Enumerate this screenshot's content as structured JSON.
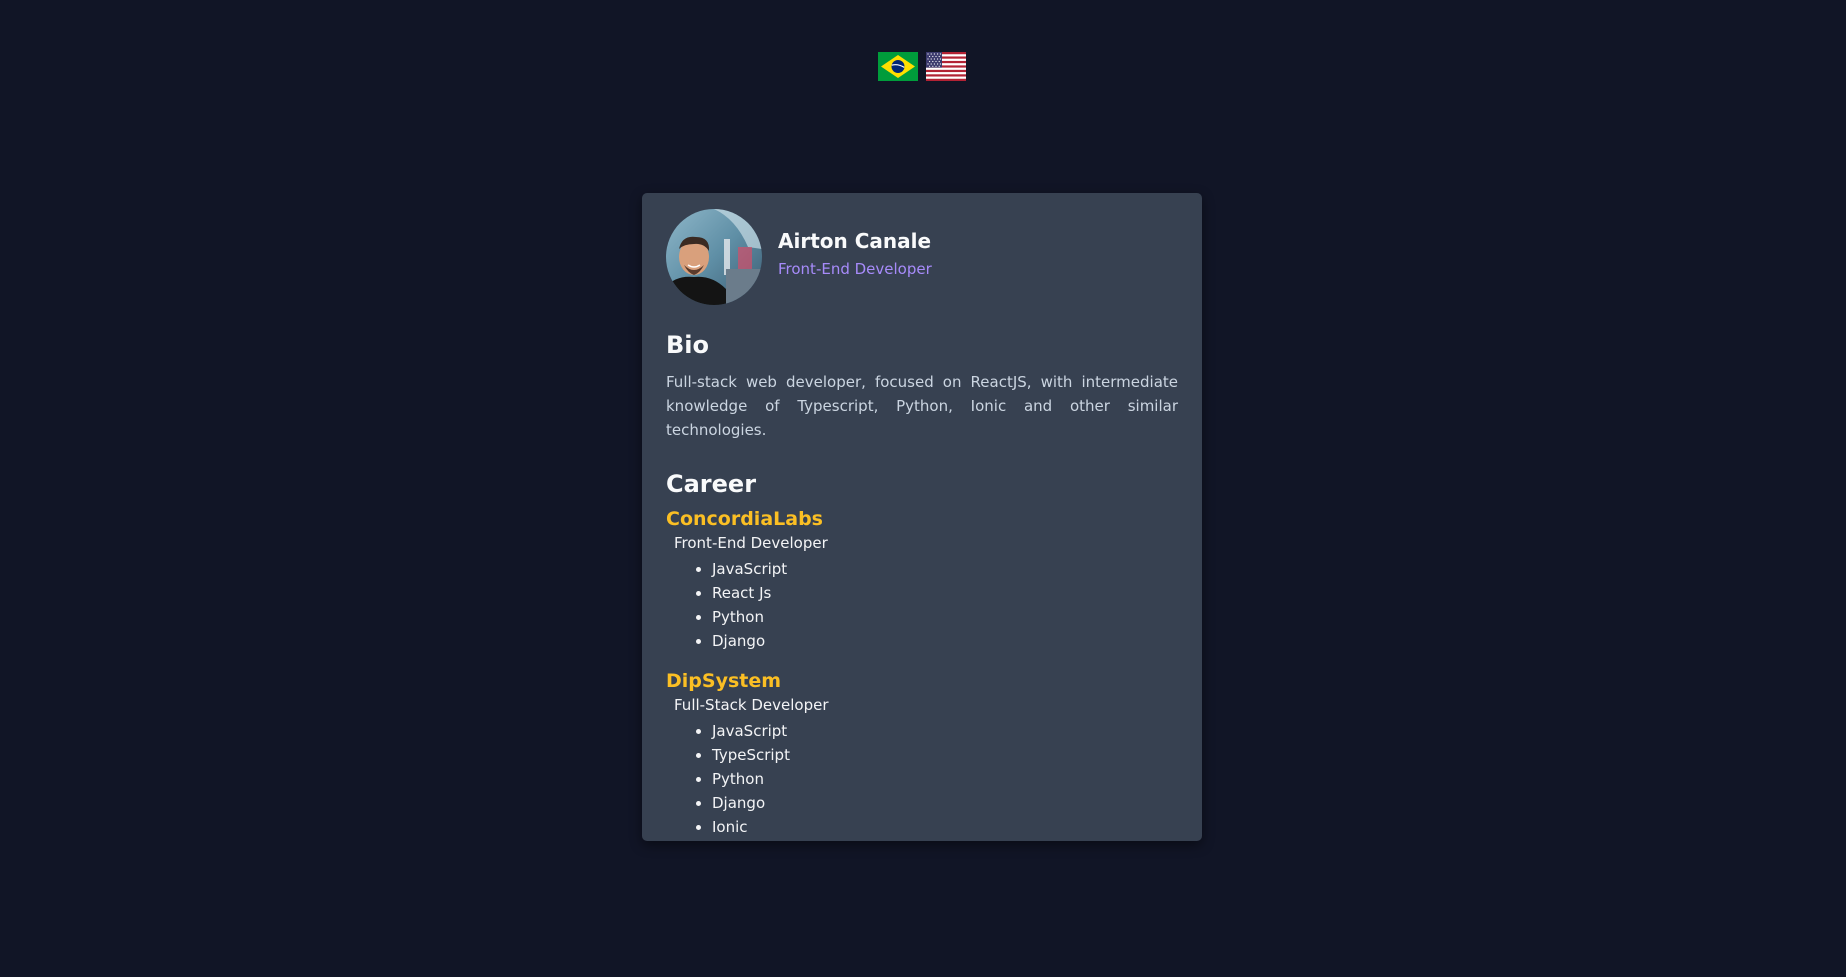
{
  "language_switcher": {
    "flags": [
      {
        "name": "brazil-flag-icon",
        "colors": {
          "green": "#009c3b",
          "yellow": "#ffdf00",
          "blue": "#002776"
        }
      },
      {
        "name": "usa-flag-icon",
        "colors": {
          "red": "#b22234",
          "white": "#ffffff",
          "blue": "#3c3b6e"
        }
      }
    ]
  },
  "profile": {
    "name": "Airton Canale",
    "role": "Front-End Developer",
    "avatar_icon": "profile-photo"
  },
  "bio": {
    "title": "Bio",
    "text": "Full-stack web developer, focused on ReactJS, with intermediate knowledge of Typescript, Python, Ionic and other similar technologies."
  },
  "career": {
    "title": "Career",
    "jobs": [
      {
        "company": "ConcordiaLabs",
        "role": "Front-End Developer",
        "skills": [
          "JavaScript",
          "React Js",
          "Python",
          "Django"
        ]
      },
      {
        "company": "DipSystem",
        "role": "Full-Stack Developer",
        "skills": [
          "JavaScript",
          "TypeScript",
          "Python",
          "Django",
          "Ionic"
        ]
      }
    ]
  },
  "colors": {
    "background": "#111526",
    "card": "#374151",
    "accent_role": "#a78bfa",
    "accent_company": "#fbbf24"
  }
}
